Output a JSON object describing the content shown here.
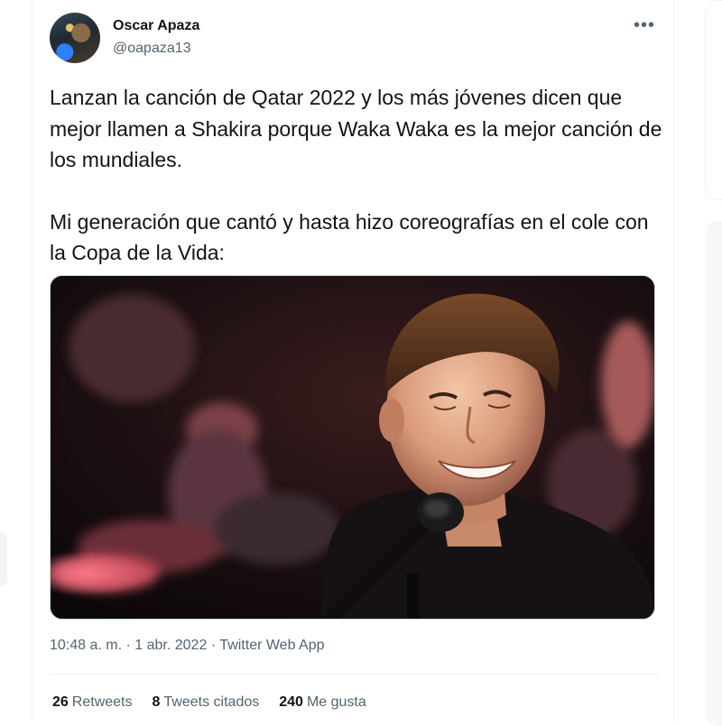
{
  "author": {
    "name": "Oscar Apaza",
    "handle": "@oapaza13",
    "avatar_icon": "profile-photo"
  },
  "more_icon": "more-horizontal-icon",
  "tweet": {
    "paragraph1": "Lanzan la canción de Qatar 2022 y los más jóvenes dicen que mejor llamen a Shakira porque Waka Waka es la mejor canción de los mundiales.",
    "paragraph2": "Mi generación que cantó y hasta hizo coreografías en el cole con la Copa de la Vida:"
  },
  "media": {
    "kind": "photo",
    "subject": "smiling singer at microphone on stage"
  },
  "meta": {
    "time": "10:48 a. m.",
    "date": "1 abr. 2022",
    "source": "Twitter Web App",
    "separator": "·"
  },
  "stats": {
    "retweets_count": "26",
    "retweets_label": "Retweets",
    "quotes_count": "8",
    "quotes_label": "Tweets citados",
    "likes_count": "240",
    "likes_label": "Me gusta"
  },
  "colors": {
    "text_primary": "#0f1419",
    "text_secondary": "#536471",
    "border": "#eff3f4"
  }
}
